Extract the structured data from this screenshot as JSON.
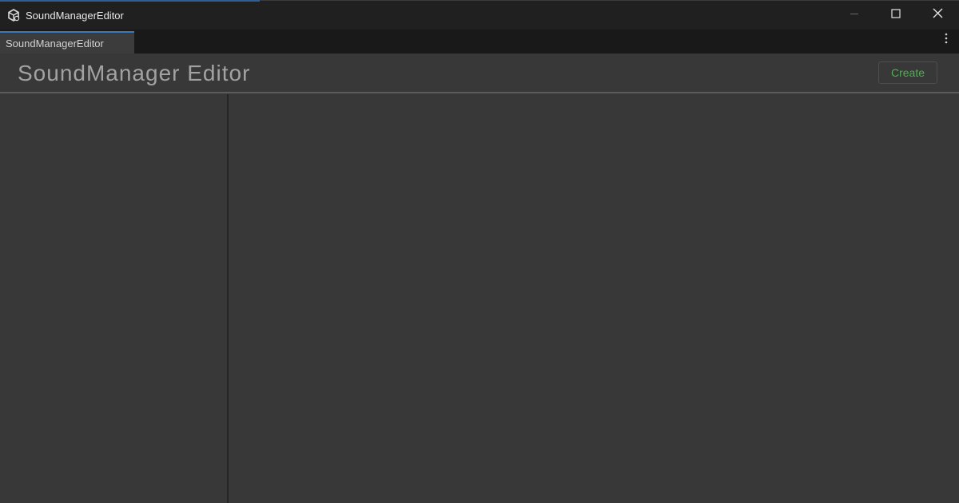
{
  "window": {
    "title": "SoundManagerEditor",
    "icon": "unity-icon"
  },
  "controls": {
    "minimize_icon": "minimize-icon",
    "maximize_icon": "maximize-icon",
    "close_icon": "close-icon"
  },
  "tabs": [
    {
      "label": "SoundManagerEditor",
      "active": true
    }
  ],
  "tab_menu_icon": "kebab-menu-icon",
  "header": {
    "title": "SoundManager Editor",
    "create_label": "Create"
  },
  "colors": {
    "background": "#383838",
    "titlebar": "#202020",
    "tab_accent": "#3a79bb",
    "create_text": "#4caf50"
  }
}
